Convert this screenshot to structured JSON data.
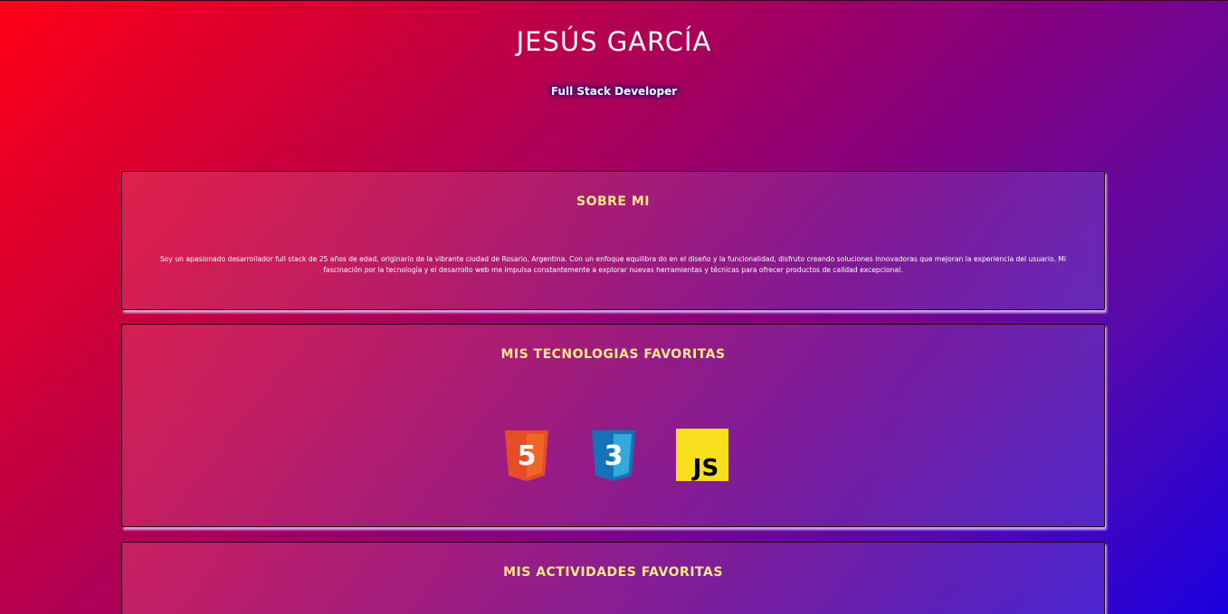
{
  "header": {
    "name": "JESÚS GARCÍA",
    "role": "Full Stack Developer"
  },
  "about": {
    "title": "SOBRE MI",
    "text": "Soy un apasionado desarrollador full stack de 25 años de edad, originario de la vibrante ciudad de Rosario, Argentina. Con un enfoque equilibra do en el diseño y la funcionalidad, disfruto creando soluciones innovadoras que mejoran la experiencia del usuario. Mi fascinación por la tecnología y el desarrollo web me impulsa constantemente a explorar nuevas herramientas y técnicas para ofrecer productos de calidad excepcional."
  },
  "technologies": {
    "title": "MIS TECNOLOGIAS FAVORITAS",
    "items": [
      {
        "name": "html5-icon",
        "label": "5",
        "color": "#e44d26"
      },
      {
        "name": "css3-icon",
        "label": "3",
        "color": "#1572b6"
      },
      {
        "name": "javascript-icon",
        "label": "JS",
        "color": "#f7df1e"
      }
    ]
  },
  "activities": {
    "title": "MIS ACTIVIDADES FAVORITAS"
  },
  "colors": {
    "accent_title": "#ffe98a",
    "background_start": "#ff0016",
    "background_end": "#1a00e0"
  }
}
